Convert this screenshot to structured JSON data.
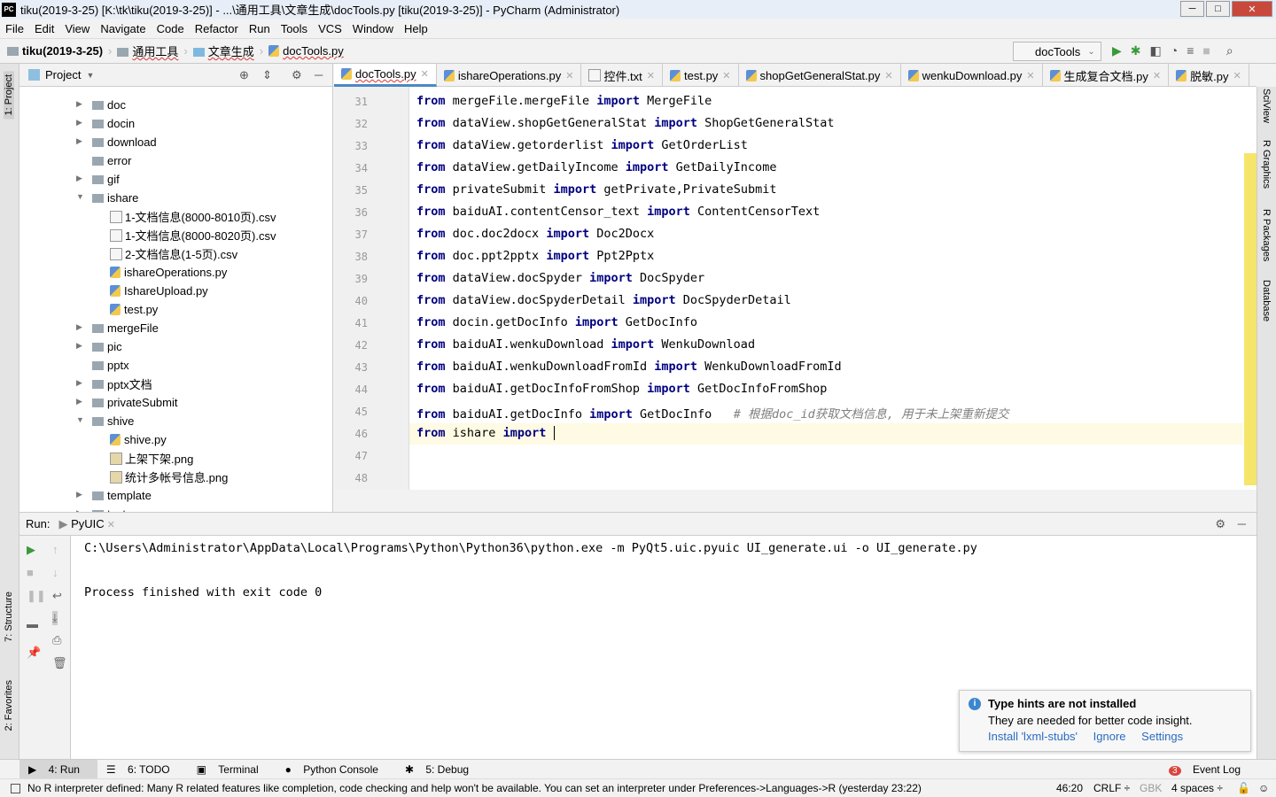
{
  "window": {
    "title": "tiku(2019-3-25) [K:\\tk\\tiku(2019-3-25)] - ...\\通用工具\\文章生成\\docTools.py [tiku(2019-3-25)] - PyCharm (Administrator)",
    "logo": "PC"
  },
  "menu": [
    "File",
    "Edit",
    "View",
    "Navigate",
    "Code",
    "Refactor",
    "Run",
    "Tools",
    "VCS",
    "Window",
    "Help"
  ],
  "breadcrumb": [
    "tiku(2019-3-25)",
    "通用工具",
    "文章生成",
    "docTools.py"
  ],
  "run_config": "docTools",
  "left_stripe": [
    "1: Project",
    "7: Structure",
    "2: Favorites"
  ],
  "right_stripe": [
    "SciView",
    "R Graphics",
    "R Packages",
    "Database"
  ],
  "project": {
    "title": "Project",
    "items": [
      {
        "label": "doc",
        "type": "folder",
        "depth": 1,
        "arrow": "right"
      },
      {
        "label": "docin",
        "type": "folder",
        "depth": 1,
        "arrow": "right"
      },
      {
        "label": "download",
        "type": "folder",
        "depth": 1,
        "arrow": "right"
      },
      {
        "label": "error",
        "type": "folder",
        "depth": 1,
        "arrow": ""
      },
      {
        "label": "gif",
        "type": "folder",
        "depth": 1,
        "arrow": "right"
      },
      {
        "label": "ishare",
        "type": "folder",
        "depth": 1,
        "arrow": "down"
      },
      {
        "label": "1-文档信息(8000-8010页).csv",
        "type": "csv",
        "depth": 2,
        "arrow": ""
      },
      {
        "label": "1-文档信息(8000-8020页).csv",
        "type": "csv",
        "depth": 2,
        "arrow": ""
      },
      {
        "label": "2-文档信息(1-5页).csv",
        "type": "csv",
        "depth": 2,
        "arrow": ""
      },
      {
        "label": "ishareOperations.py",
        "type": "py",
        "depth": 2,
        "arrow": ""
      },
      {
        "label": "IshareUpload.py",
        "type": "py",
        "depth": 2,
        "arrow": ""
      },
      {
        "label": "test.py",
        "type": "py",
        "depth": 2,
        "arrow": ""
      },
      {
        "label": "mergeFile",
        "type": "folder",
        "depth": 1,
        "arrow": "right"
      },
      {
        "label": "pic",
        "type": "folder",
        "depth": 1,
        "arrow": "right"
      },
      {
        "label": "pptx",
        "type": "folder",
        "depth": 1,
        "arrow": ""
      },
      {
        "label": "pptx文档",
        "type": "folder",
        "depth": 1,
        "arrow": "right"
      },
      {
        "label": "privateSubmit",
        "type": "folder",
        "depth": 1,
        "arrow": "right"
      },
      {
        "label": "shive",
        "type": "folder",
        "depth": 1,
        "arrow": "down"
      },
      {
        "label": "shive.py",
        "type": "py",
        "depth": 2,
        "arrow": ""
      },
      {
        "label": "上架下架.png",
        "type": "img",
        "depth": 2,
        "arrow": ""
      },
      {
        "label": "统计多帐号信息.png",
        "type": "img",
        "depth": 2,
        "arrow": ""
      },
      {
        "label": "template",
        "type": "folder",
        "depth": 1,
        "arrow": "right"
      },
      {
        "label": "test",
        "type": "folder",
        "depth": 1,
        "arrow": "right"
      }
    ]
  },
  "tabs": [
    {
      "label": "docTools.py",
      "active": true
    },
    {
      "label": "ishareOperations.py"
    },
    {
      "label": "控件.txt"
    },
    {
      "label": "test.py"
    },
    {
      "label": "shopGetGeneralStat.py"
    },
    {
      "label": "wenkuDownload.py"
    },
    {
      "label": "生成复合文档.py"
    },
    {
      "label": "脱敏.py"
    }
  ],
  "code": [
    {
      "n": "31",
      "mod": "mergeFile.mergeFile",
      "name": "MergeFile"
    },
    {
      "n": "32",
      "mod": "dataView.shopGetGeneralStat",
      "name": "ShopGetGeneralStat"
    },
    {
      "n": "33",
      "mod": "dataView.getorderlist",
      "name": "GetOrderList"
    },
    {
      "n": "34",
      "mod": "dataView.getDailyIncome",
      "name": "GetDailyIncome"
    },
    {
      "n": "35",
      "mod": "privateSubmit",
      "name": "getPrivate,PrivateSubmit"
    },
    {
      "n": "36",
      "mod": "baiduAI.contentCensor_text",
      "name": "ContentCensorText"
    },
    {
      "n": "37",
      "mod": "doc.doc2docx",
      "name": "Doc2Docx"
    },
    {
      "n": "38",
      "mod": "doc.ppt2pptx",
      "name": "Ppt2Pptx"
    },
    {
      "n": "39",
      "mod": "dataView.docSpyder",
      "name": "DocSpyder"
    },
    {
      "n": "40",
      "mod": "dataView.docSpyderDetail",
      "name": "DocSpyderDetail"
    },
    {
      "n": "41",
      "mod": "docin.getDocInfo",
      "name": "GetDocInfo"
    },
    {
      "n": "42",
      "mod": "baiduAI.wenkuDownload",
      "name": "WenkuDownload"
    },
    {
      "n": "43",
      "mod": "baiduAI.wenkuDownloadFromId",
      "name": "WenkuDownloadFromId"
    },
    {
      "n": "44",
      "mod": "baiduAI.getDocInfoFromShop",
      "name": "GetDocInfoFromShop"
    },
    {
      "n": "45",
      "mod": "baiduAI.getDocInfo",
      "name": "GetDocInfo",
      "comment": "# 根据doc_id获取文档信息, 用于未上架重新提交"
    },
    {
      "n": "46",
      "mod": "ishare",
      "name": ""
    },
    {
      "n": "47"
    },
    {
      "n": "48"
    }
  ],
  "kw": {
    "from": "from",
    "import": "import"
  },
  "run": {
    "label": "Run:",
    "tab": "PyUIC",
    "output": [
      "C:\\Users\\Administrator\\AppData\\Local\\Programs\\Python\\Python36\\python.exe -m PyQt5.uic.pyuic UI_generate.ui -o UI_generate.py",
      "",
      "Process finished with exit code 0"
    ]
  },
  "notification": {
    "title": "Type hints are not installed",
    "body": "They are needed for better code insight.",
    "links": [
      "Install 'lxml-stubs'",
      "Ignore",
      "Settings"
    ]
  },
  "bottom_tools": [
    "4: Run",
    "6: TODO",
    "Terminal",
    "Python Console",
    "5: Debug"
  ],
  "event_log": {
    "label": "Event Log",
    "count": "3"
  },
  "status": {
    "message": "No R interpreter defined: Many R related features like completion, code checking and help won't be available. You can set an interpreter under Preferences->Languages->R (yesterday 23:22)",
    "position": "46:20",
    "line_sep": "CRLF ÷",
    "encoding": "GBK",
    "indent": "4 spaces ÷"
  }
}
